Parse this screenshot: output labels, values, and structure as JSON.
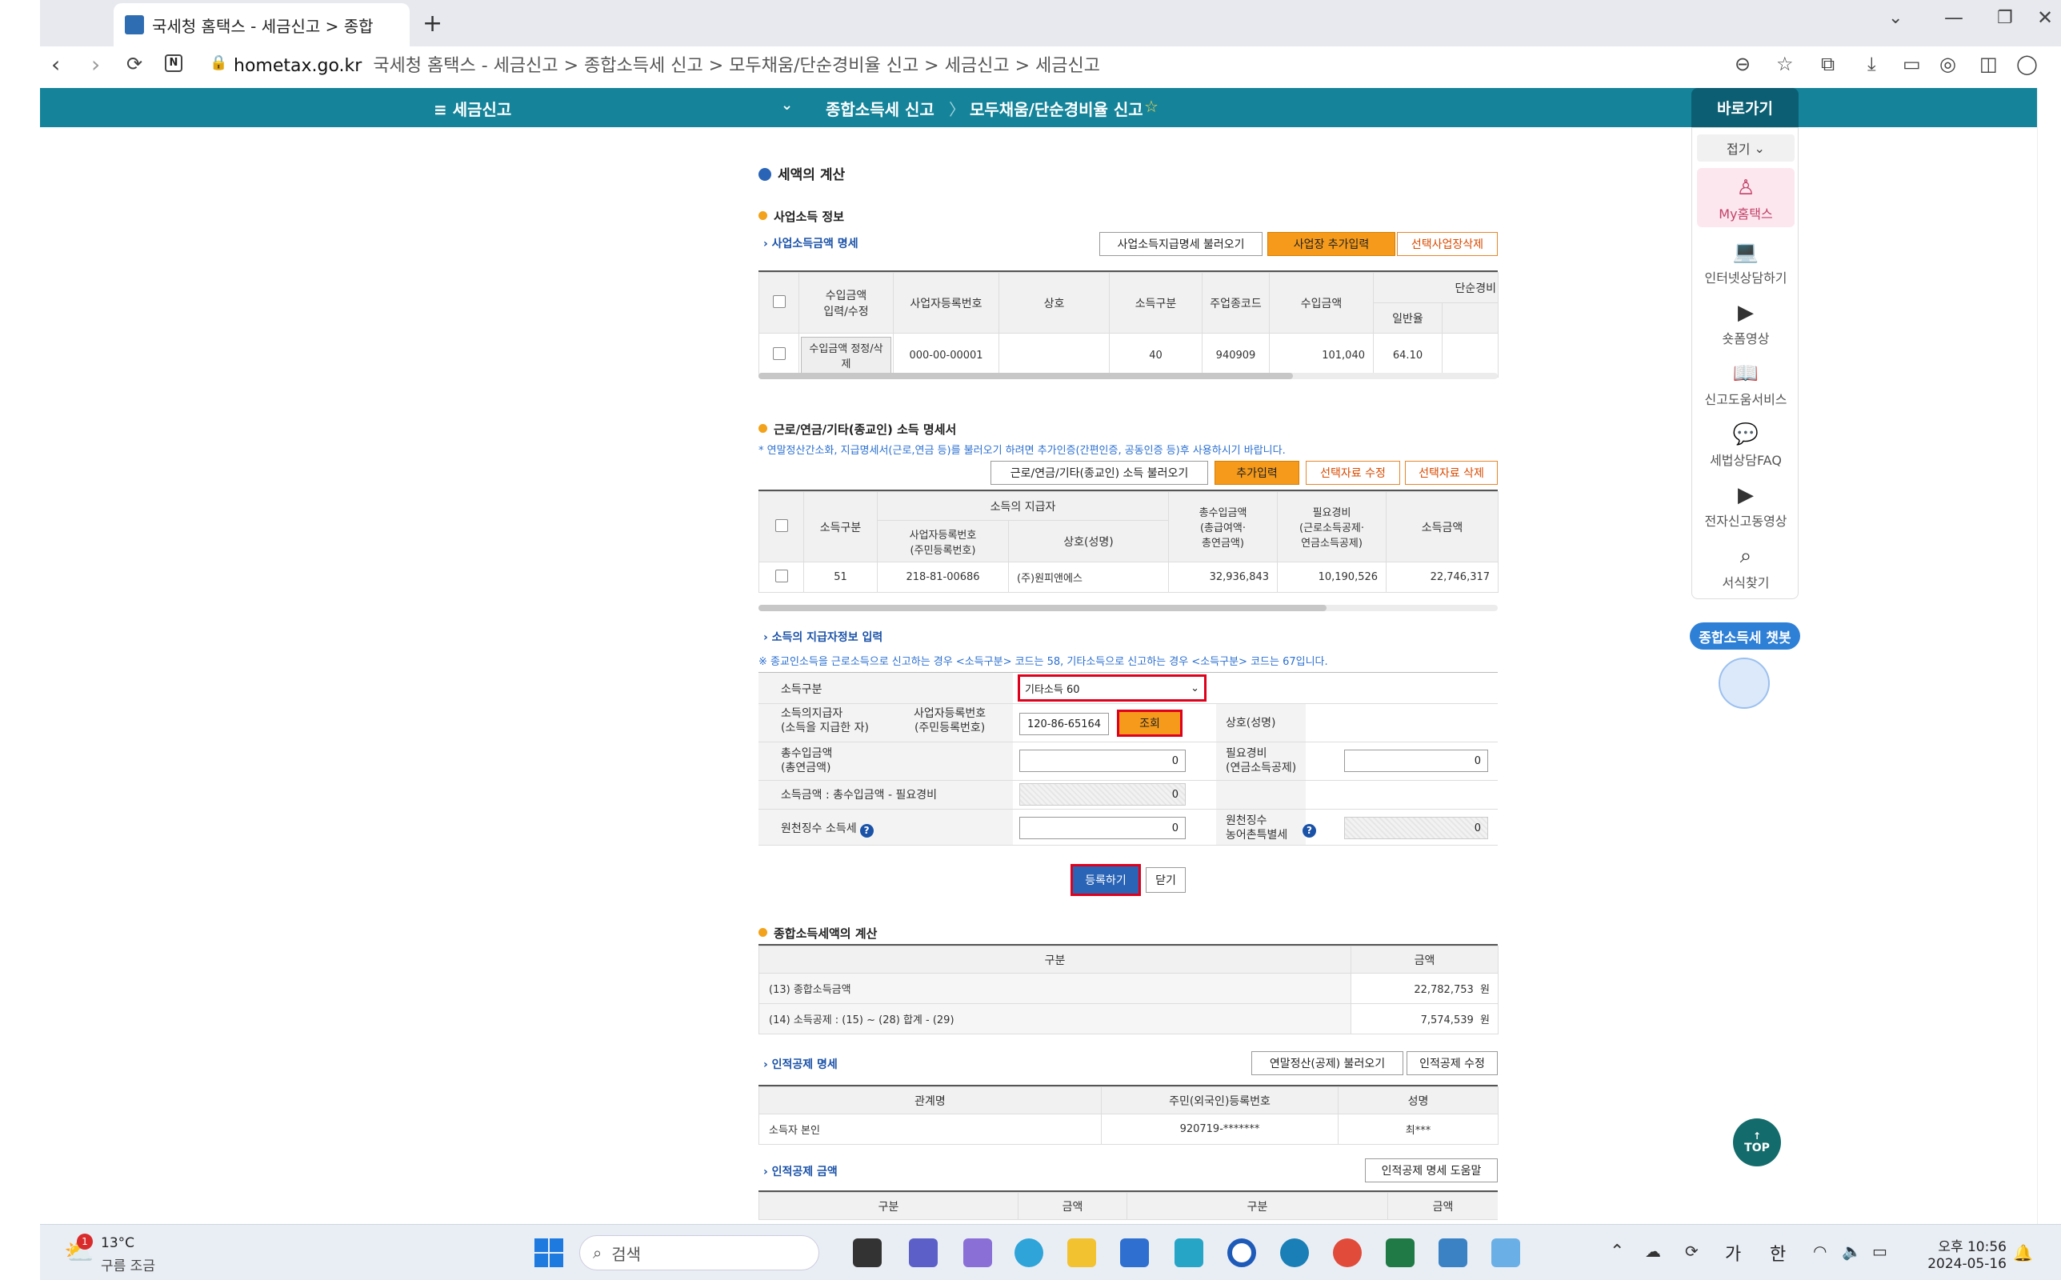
{
  "browser": {
    "tab_title": "국세청 홈택스 - 세금신고 > 종합",
    "url_domain": "hometax.go.kr",
    "url_rest": "국세청 홈택스 - 세금신고 > 종합소득세 신고 > 모두채움/단순경비율 신고 > 세금신고 > 세금신고"
  },
  "header": {
    "menu": "≡  세금신고",
    "crumb1": "종합소득세 신고",
    "crumb2": "모두채움/단순경비율 신고",
    "quick": "바로가기"
  },
  "quick": {
    "collapse": "접기",
    "items": [
      "My홈택스",
      "인터넷상담하기",
      "숏폼영상",
      "신고도움서비스",
      "세법상담FAQ",
      "전자신고동영상",
      "서식찾기"
    ],
    "chatbot": "종합소득세 챗봇",
    "top": "TOP"
  },
  "calc": {
    "title": "세액의 계산",
    "biz_title": "사업소득 정보",
    "biz_sub": "사업소득금액 명세",
    "btn_load": "사업소득지급명세 불러오기",
    "btn_add": "사업장 추가입력",
    "btn_del": "선택사업장삭제",
    "biz_headers": [
      "수입금액\n입력/수정",
      "사업자등록번호",
      "상호",
      "소득구분",
      "주업종코드",
      "수입금액",
      "단순경비",
      "일반율"
    ],
    "biz_row": {
      "edit": "수입금액 정정/삭제",
      "regno": "000-00-00001",
      "name": "",
      "type": "40",
      "code": "940909",
      "amount": "101,040",
      "rate": "64.10"
    },
    "wage_title": "근로/연금/기타(종교인) 소득 명세서",
    "wage_note": "* 연말정산간소화, 지급명세서(근로,연금 등)를 불러오기 하려면 추가인증(간편인증, 공동인증 등)후 사용하시기 바랍니다.",
    "btn_wage_load": "근로/연금/기타(종교인) 소득 불러오기",
    "btn_wage_add": "추가입력",
    "btn_wage_edit": "선택자료 수정",
    "btn_wage_del": "선택자료 삭제",
    "wage_headers": [
      "소득구분",
      "소득의 지급자",
      "사업자등록번호\n(주민등록번호)",
      "상호(성명)",
      "총수입금액\n(총급여액·\n총연금액)",
      "필요경비\n(근로소득공제·\n연금소득공제)",
      "소득금액"
    ],
    "wage_row": {
      "type": "51",
      "regno": "218-81-00686",
      "name": "(주)원피앤에스",
      "total": "32,936,843",
      "expense": "10,190,526",
      "income": "22,746,317"
    },
    "payer_sub": "소득의 지급자정보 입력",
    "payer_note": "※ 종교인소득을 근로소득으로 신고하는 경우 <소득구분> 코드는 58, 기타소득으로 신고하는 경우 <소득구분> 코드는 67입니다.",
    "form": {
      "type_label": "소득구분",
      "type_value": "기타소득 60",
      "payer_label": "소득의지급자\n(소득을 지급한 자)",
      "regno_label": "사업자등록번호\n(주민등록번호)",
      "regno_value": "120-86-65164",
      "lookup": "조회",
      "name_label": "상호(성명)",
      "total_label": "총수입금액\n(총연금액)",
      "total_value": "0",
      "expense_label": "필요경비\n(연금소득공제)",
      "expense_value": "0",
      "income_label": "소득금액 : 총수입금액 - 필요경비",
      "income_value": "0",
      "tax_label": "원천징수 소득세",
      "tax_value": "0",
      "rural_label": "원천징수\n농어촌특별세",
      "rural_value": "0"
    },
    "btn_register": "등록하기",
    "btn_close": "닫기",
    "total_title": "종합소득세액의 계산",
    "total_headers": [
      "구분",
      "금액"
    ],
    "total_rows": [
      {
        "label": "(13) 종합소득금액",
        "value": "22,782,753",
        "unit": "원"
      },
      {
        "label": "(14) 소득공제 : (15) ~ (28) 합계 - (29)",
        "value": "7,574,539",
        "unit": "원"
      }
    ],
    "personal_sub": "인적공제 명세",
    "btn_personal_load": "연말정산(공제) 불러오기",
    "btn_personal_edit": "인적공제 수정",
    "personal_headers": [
      "관계명",
      "주민(외국인)등록번호",
      "성명"
    ],
    "personal_row": {
      "rel": "소득자 본인",
      "id": "920719-*******",
      "name": "최***"
    },
    "pamount_sub": "인적공제 금액",
    "btn_pamount_help": "인적공제 명세 도움말",
    "pamount_headers": [
      "구분",
      "금액",
      "구분",
      "금액"
    ]
  },
  "taskbar": {
    "temp": "13°C",
    "weather": "구름 조금",
    "search": "검색",
    "ime1": "가",
    "ime2": "한",
    "time": "오후 10:56",
    "date": "2024-05-16",
    "badge": "1"
  }
}
